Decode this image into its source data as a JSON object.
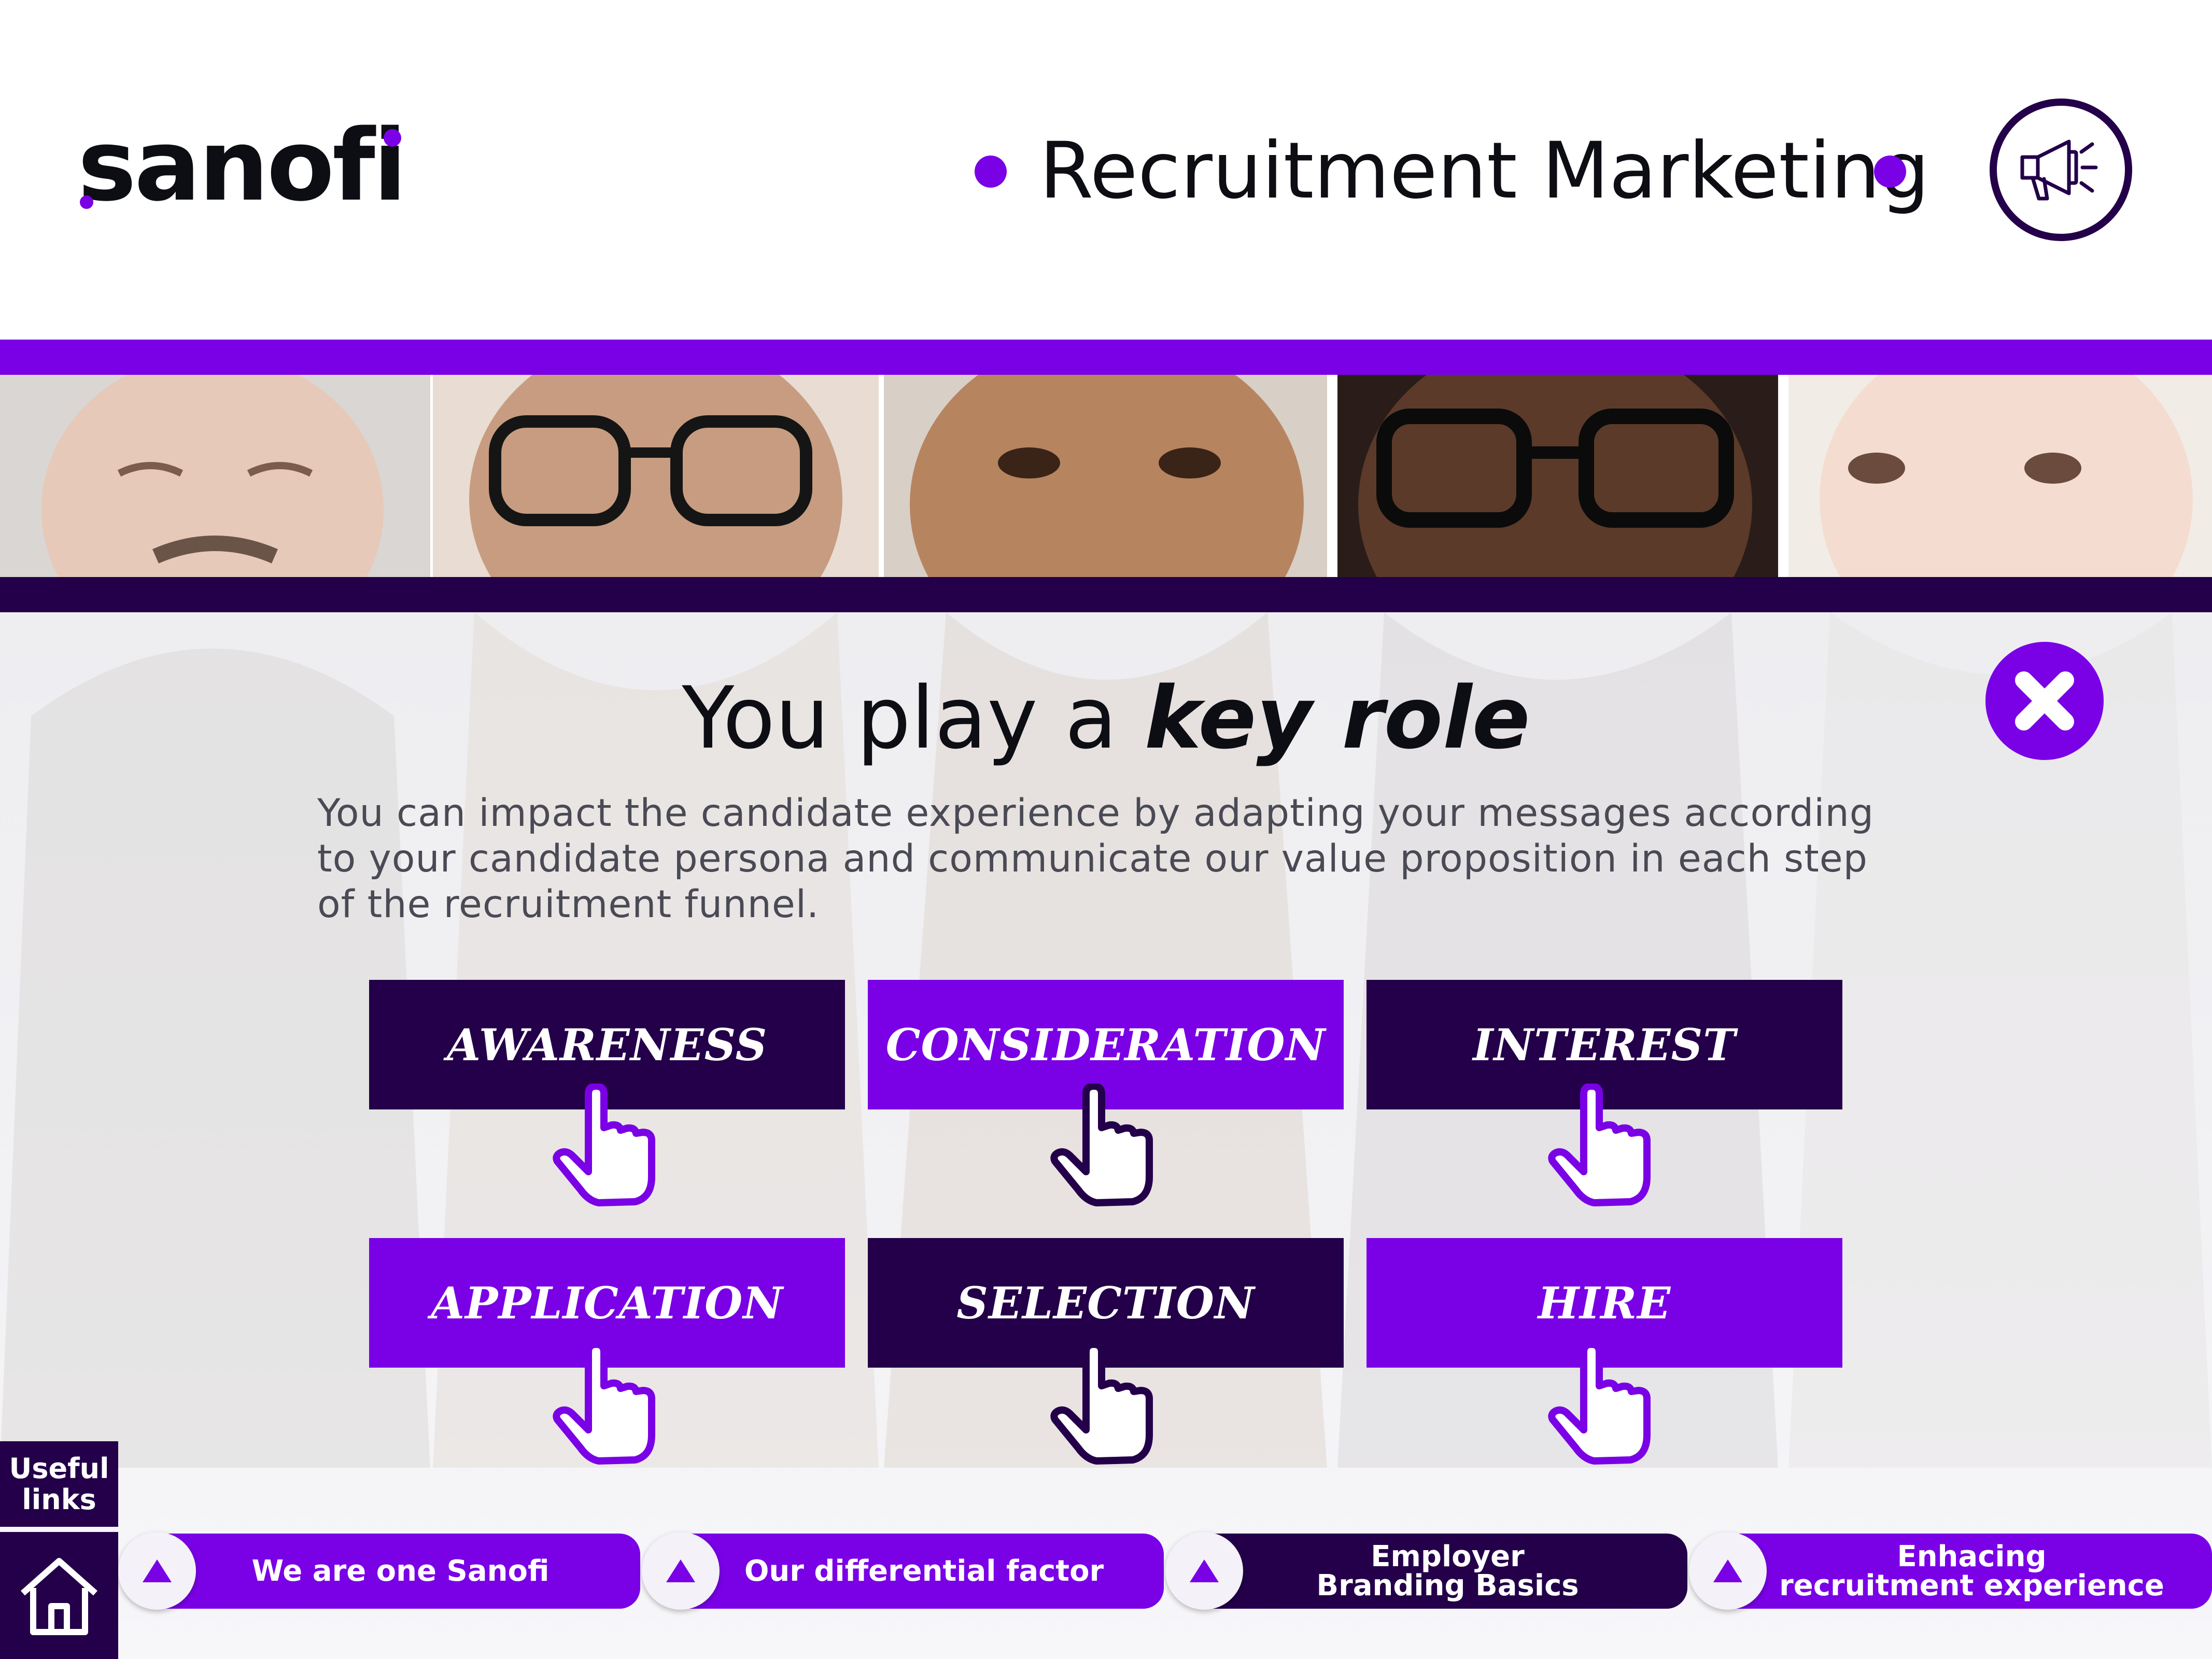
{
  "header": {
    "logo_text": "sanofi",
    "title": "Recruitment Marketing",
    "icon": "megaphone-icon"
  },
  "main": {
    "heading_regular": "You play a ",
    "heading_bold": "key role",
    "intro_lines": [
      "You can impact the candidate experience by adapting your messages according",
      "to your candidate persona and communicate our value proposition in each step",
      "of the recruitment funnel."
    ],
    "close_icon": "close-icon"
  },
  "steps": [
    {
      "label": "AWARENESS",
      "color": "#230049"
    },
    {
      "label": "CONSIDERATION",
      "color": "#7a00e6"
    },
    {
      "label": "INTEREST",
      "color": "#230049"
    },
    {
      "label": "APPLICATION",
      "color": "#7a00e6"
    },
    {
      "label": "SELECTION",
      "color": "#230049"
    },
    {
      "label": "HIRE",
      "color": "#7a00e6"
    }
  ],
  "footer": {
    "useful_links": "Useful links",
    "home_icon": "home-icon",
    "nav": [
      {
        "label": "We are one Sanofi"
      },
      {
        "label": "Our differential factor"
      },
      {
        "label_line1": "Employer",
        "label_line2": "Branding Basics"
      },
      {
        "label_line1": "Enhacing",
        "label_line2": "recruitment experience"
      }
    ]
  },
  "colors": {
    "brand_purple": "#7a00e6",
    "brand_dark": "#230049",
    "text": "#0d0d14"
  }
}
